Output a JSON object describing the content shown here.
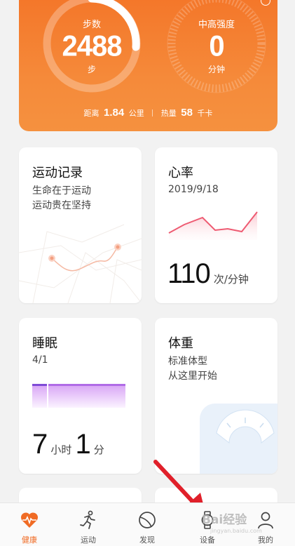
{
  "hero": {
    "steps": {
      "label": "步数",
      "value": "2488",
      "unit": "步"
    },
    "intensity": {
      "label": "中高强度",
      "value": "0",
      "unit": "分钟"
    },
    "distance_label": "距离",
    "distance_value": "1.84",
    "distance_unit": "公里",
    "calories_label": "热量",
    "calories_value": "58",
    "calories_unit": "千卡",
    "accent": "#f4772a"
  },
  "cards": {
    "exercise": {
      "title": "运动记录",
      "line1": "生命在于运动",
      "line2": "运动贵在坚持"
    },
    "heart": {
      "title": "心率",
      "date": "2019/9/18",
      "value": "110",
      "unit": "次/分钟"
    },
    "sleep": {
      "title": "睡眠",
      "date": "4/1",
      "hours": "7",
      "hours_unit": "小时",
      "minutes": "1",
      "minutes_unit": "分"
    },
    "weight": {
      "title": "体重",
      "line1": "标准体型",
      "line2": "从这里开始"
    }
  },
  "nav": {
    "items": [
      {
        "label": "健康",
        "icon": "heart-pulse-icon",
        "active": true
      },
      {
        "label": "运动",
        "icon": "running-icon",
        "active": false
      },
      {
        "label": "发现",
        "icon": "discover-icon",
        "active": false
      },
      {
        "label": "设备",
        "icon": "watch-icon",
        "active": false
      },
      {
        "label": "我的",
        "icon": "person-icon",
        "active": false
      }
    ]
  },
  "watermark": {
    "text": "Bai经验",
    "url": "jingyan.baidu.com"
  }
}
